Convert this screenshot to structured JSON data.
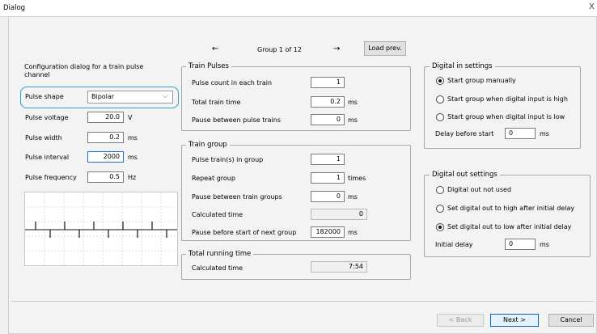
{
  "window": {
    "title": "Dialog",
    "close_glyph": "X"
  },
  "nav": {
    "prev_arrow": "←",
    "group_label": "Group 1 of 12",
    "next_arrow": "→",
    "load_prev": "Load prev."
  },
  "left": {
    "description": "Configuration dialog for a train pulse channel",
    "pulse_shape_label": "Pulse shape",
    "pulse_shape_value": "Bipolar",
    "pulse_voltage_label": "Pulse voltage",
    "pulse_voltage_value": "20.0",
    "pulse_voltage_unit": "V",
    "pulse_width_label": "Pulse width",
    "pulse_width_value": "0.2",
    "pulse_width_unit": "ms",
    "pulse_interval_label": "Pulse interval",
    "pulse_interval_value": "2000",
    "pulse_interval_unit": "ms",
    "pulse_frequency_label": "Pulse frequency",
    "pulse_frequency_value": "0.5",
    "pulse_frequency_unit": "Hz"
  },
  "train_pulses": {
    "legend": "Train Pulses",
    "count_label": "Pulse count in each train",
    "count_value": "1",
    "total_label": "Total train time",
    "total_value": "0.2",
    "total_unit": "ms",
    "pause_label": "Pause between pulse trains",
    "pause_value": "0",
    "pause_unit": "ms"
  },
  "train_group": {
    "legend": "Train group",
    "trains_label": "Pulse train(s) in group",
    "trains_value": "1",
    "repeat_label": "Repeat group",
    "repeat_value": "1",
    "repeat_unit": "times",
    "pause_label": "Pause between train groups",
    "pause_value": "0",
    "pause_unit": "ms",
    "calc_label": "Calculated time",
    "calc_value": "0",
    "next_label": "Pause before start of next group",
    "next_value": "182000",
    "next_unit": "ms"
  },
  "total_running": {
    "legend": "Total running time",
    "calc_label": "Calculated time",
    "calc_value": "7:54"
  },
  "digital_in": {
    "legend": "Digital in settings",
    "options": [
      "Start group manually",
      "Start group when digital input is high",
      "Start group when digital input is low"
    ],
    "selected": 0,
    "delay_label": "Delay before start",
    "delay_value": "0",
    "delay_unit": "ms"
  },
  "digital_out": {
    "legend": "Digital out settings",
    "options": [
      "Digital out not used",
      "Set digital out to high after initial delay",
      "Set digital out to low after initial delay"
    ],
    "selected": 2,
    "initial_delay_label": "Initial delay",
    "initial_delay_value": "0",
    "initial_delay_unit": "ms"
  },
  "footer": {
    "back": "< Back",
    "next": "Next >",
    "cancel": "Cancel"
  },
  "colors": {
    "highlight": "#2e9dc8",
    "primary_border": "#0a64c8"
  }
}
